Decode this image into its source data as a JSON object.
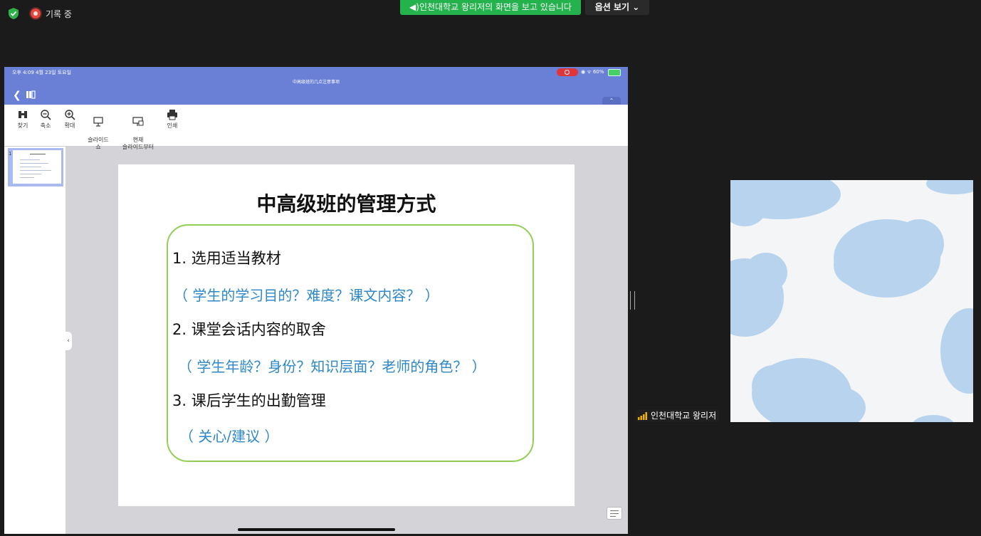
{
  "top_bar": {
    "recording_label": "기록 중",
    "share_banner": "인천대학교 왕리저의 화면을 보고 있습니다",
    "view_options": "옵션 보기"
  },
  "ipad": {
    "status_time": "오후 4:09   4월 23일 토요일",
    "status_right": "◉ ᯤ 60%",
    "doc_title": "中高级班的几点注意事项",
    "toolbar": [
      {
        "label": "찾기",
        "icon": "binoculars-icon"
      },
      {
        "label": "축소",
        "icon": "zoom-out-icon"
      },
      {
        "label": "확대",
        "icon": "zoom-in-icon"
      },
      {
        "label": "슬라이드\n쇼",
        "icon": "slideshow-icon"
      },
      {
        "label": "현재\n슬라이드부터",
        "icon": "slideshow-current-icon"
      },
      {
        "label": "인쇄",
        "icon": "print-icon"
      }
    ],
    "thumb_number": "1"
  },
  "slide": {
    "title": "中高级班的管理方式",
    "item1": "1.  选用适当教材",
    "sub1": "（ 学生的学习目的？难度？课文内容？ ）",
    "item2": "2. 课堂会话内容的取舍",
    "sub2": "（ 学生年龄？身份？知识层面？老师的角色？ ）",
    "item3": "3. 课后学生的出勤管理",
    "sub3": "（ 关心/建议 ）"
  },
  "participant": {
    "name": "인천대학교 왕리저",
    "accent": "#23b24b"
  },
  "colors": {
    "ipad_header": "#6a80d6",
    "slide_border": "#92cf55",
    "sub_text": "#2e87c7"
  }
}
